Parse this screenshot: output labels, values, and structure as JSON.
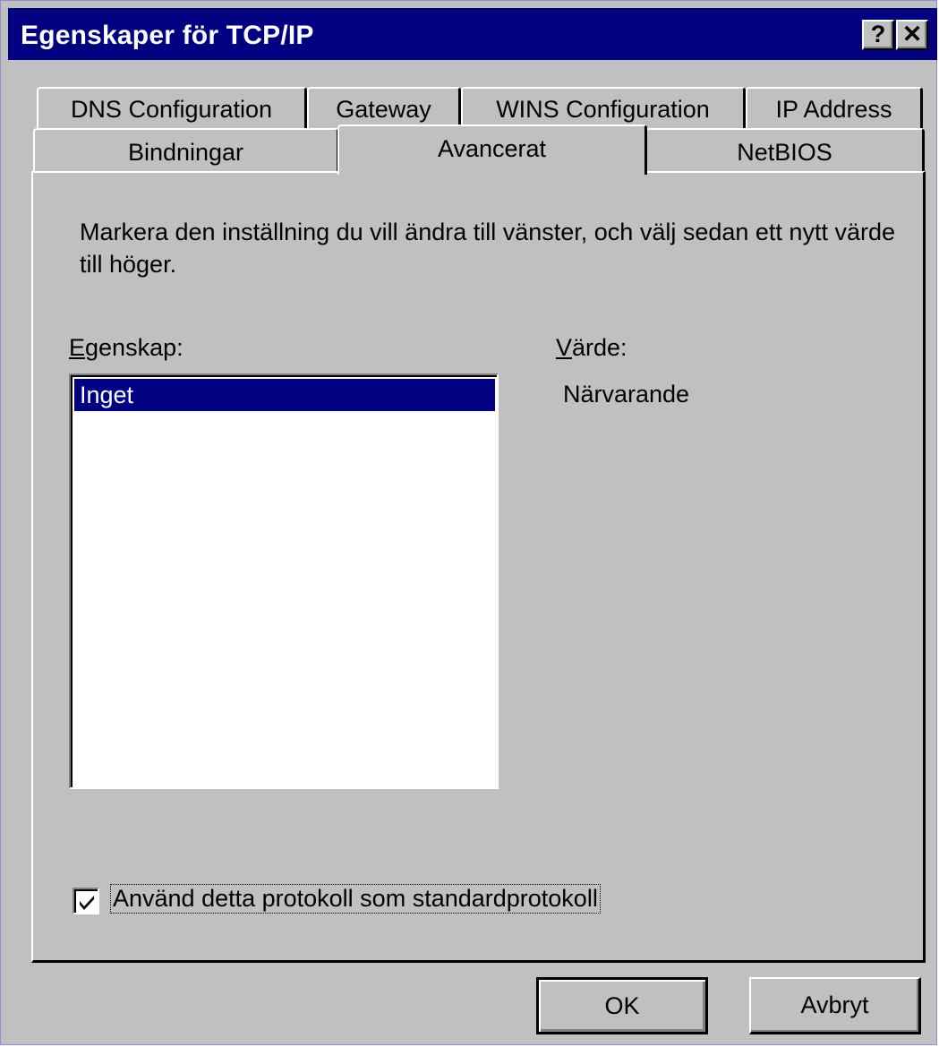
{
  "window": {
    "title": "Egenskaper för TCP/IP",
    "help_button": "?",
    "close_button": "✕"
  },
  "tabs": {
    "row1": [
      "DNS Configuration",
      "Gateway",
      "WINS Configuration",
      "IP Address"
    ],
    "row2": [
      "Bindningar",
      "Avancerat",
      "NetBIOS"
    ],
    "active": "Avancerat"
  },
  "advanced": {
    "description": "Markera den inställning du vill ändra till vänster, och välj sedan ett nytt värde till höger.",
    "property_label_mnemonic": "E",
    "property_label_rest": "genskap:",
    "value_label_mnemonic": "V",
    "value_label_rest": "ärde:",
    "property_items": [
      "Inget"
    ],
    "selected_property": "Inget",
    "value": "Närvarande",
    "default_protocol_checkbox": {
      "label": "Använd detta protokoll som standardprotokoll",
      "checked": true
    }
  },
  "buttons": {
    "ok": "OK",
    "cancel": "Avbryt"
  },
  "colors": {
    "title_bar": "#000080",
    "dialog_face": "#c0c0c0",
    "selection": "#000080"
  }
}
